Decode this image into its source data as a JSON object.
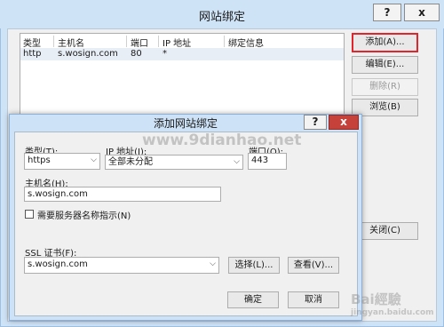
{
  "outer": {
    "title": "网站绑定",
    "help": "?",
    "close": "x",
    "columns": [
      "类型",
      "主机名",
      "端口",
      "IP 地址",
      "绑定信息"
    ],
    "row": {
      "type": "http",
      "host": "s.wosign.com",
      "port": "80",
      "ip": "*",
      "info": ""
    },
    "buttons": {
      "add": "添加(A)...",
      "edit": "编辑(E)...",
      "remove": "删除(R)",
      "browse": "浏览(B)",
      "close": "关闭(C)"
    }
  },
  "inner": {
    "title": "添加网站绑定",
    "help": "?",
    "close": "x",
    "type_label": "类型(T):",
    "type_value": "https",
    "ip_label": "IP 地址(I):",
    "ip_value": "全部未分配",
    "port_label": "端口(O):",
    "port_value": "443",
    "host_label": "主机名(H):",
    "host_value": "s.wosign.com",
    "sni_label": "需要服务器名称指示(N)",
    "ssl_label": "SSL 证书(F):",
    "ssl_value": "s.wosign.com",
    "select_btn": "选择(L)...",
    "view_btn": "查看(V)...",
    "ok_btn": "确定",
    "cancel_btn": "取消"
  },
  "watermarks": {
    "url": "www.9dianhao.net",
    "site": "Bai經驗",
    "domain": "jingyan.baidu.com"
  },
  "accent_color": "#e0262c"
}
